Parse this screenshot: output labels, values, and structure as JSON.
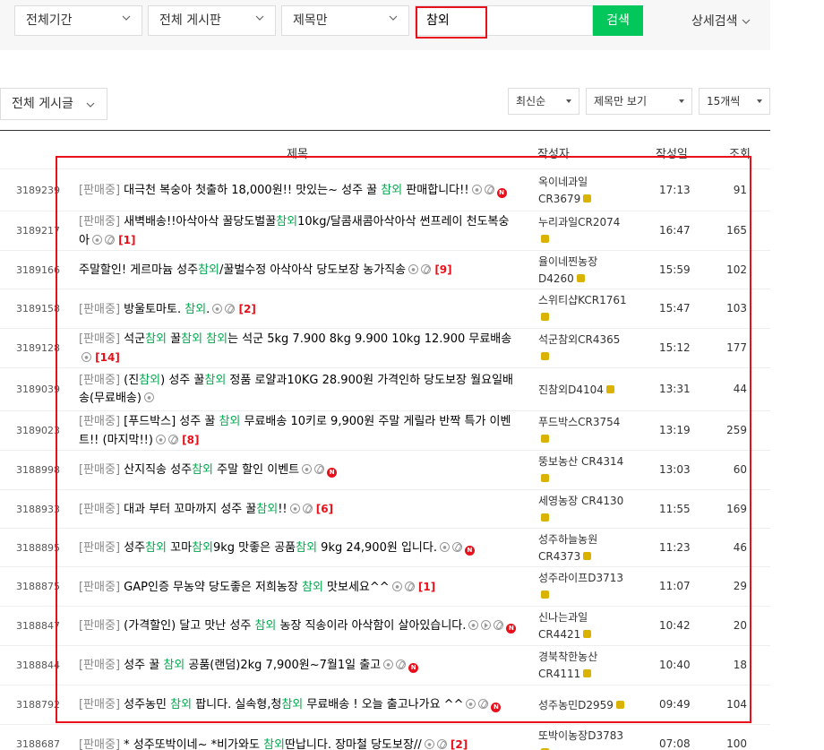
{
  "search": {
    "period": "전체기간",
    "board": "전체 게시판",
    "field": "제목만",
    "query": "참외",
    "button": "검색",
    "advanced": "상세검색"
  },
  "toolbar": {
    "all_posts": "전체 게시글",
    "sort": "최신순",
    "view": "제목만 보기",
    "count": "15개씩"
  },
  "table": {
    "headers": {
      "title": "제목",
      "author": "작성자",
      "date": "작성일",
      "views": "조회"
    },
    "rows": [
      {
        "num": "3189239",
        "head": "[판매중]",
        "parts": [
          "대극천 복숭아 첫출하 18,000원!! 맛있는~ 성주 꿀 ",
          "참외",
          " 판매합니다!!"
        ],
        "icons": [
          "photo",
          "attach",
          "new"
        ],
        "comments": "",
        "author": "옥이네과일 CR3679",
        "date": "17:13",
        "views": "91"
      },
      {
        "num": "3189217",
        "head": "[판매중]",
        "parts": [
          "새벽배송!!아삭아삭 꿀당도벌꿀",
          "참외",
          "10kg/달콤새콤아삭아삭 썬프레이 천도복숭아"
        ],
        "icons": [
          "photo",
          "attach"
        ],
        "comments": "[1]",
        "author": "누리과일CR2074",
        "date": "16:47",
        "views": "165"
      },
      {
        "num": "3189166",
        "head": "",
        "parts": [
          "주말할인! 게르마늄 성주",
          "참외",
          "/꿀벌수정 아삭아삭 당도보장 농가직송"
        ],
        "icons": [
          "photo",
          "attach"
        ],
        "comments": "[9]",
        "author": "율이네찐농장 D4260",
        "date": "15:59",
        "views": "102"
      },
      {
        "num": "3189158",
        "head": "[판매중]",
        "parts": [
          "방울토마토. ",
          "참외",
          "."
        ],
        "icons": [
          "photo",
          "attach"
        ],
        "comments": "[2]",
        "author": "스위티샵KCR1761",
        "date": "15:47",
        "views": "103"
      },
      {
        "num": "3189128",
        "head": "[판매중]",
        "parts": [
          "석군",
          "참외",
          " 꿀",
          "참외",
          " ",
          "참외",
          "는 석군 5kg 7.900 8kg 9.900 10kg 12.900 무료배송"
        ],
        "icons": [
          "photo"
        ],
        "comments": "[14]",
        "author": "석군참외CR4365",
        "date": "15:12",
        "views": "177"
      },
      {
        "num": "3189039",
        "head": "[판매중]",
        "parts": [
          "(진",
          "참외",
          ") 성주 꿀",
          "참외",
          " 정품 로얄과10KG 28.900원 가격인하 당도보장 월요일배송(무료배송)"
        ],
        "icons": [
          "photo"
        ],
        "comments": "",
        "author": "진참외D4104",
        "date": "13:31",
        "views": "44"
      },
      {
        "num": "3189023",
        "head": "[판매중]",
        "parts": [
          "[푸드박스] 성주 꿀 ",
          "참외",
          " 무료배송 10키로 9,900원 주말 게릴라 반짝 특가 이벤트!! (마지막!!)"
        ],
        "icons": [
          "photo",
          "attach"
        ],
        "comments": "[8]",
        "author": "푸드박스CR3754",
        "date": "13:19",
        "views": "259"
      },
      {
        "num": "3188998",
        "head": "[판매중]",
        "parts": [
          "산지직송 성주",
          "참외",
          " 주말 할인 이벤트"
        ],
        "icons": [
          "photo",
          "attach",
          "new"
        ],
        "comments": "",
        "author": "뚱보농산 CR4314",
        "date": "13:03",
        "views": "60"
      },
      {
        "num": "3188933",
        "head": "[판매중]",
        "parts": [
          "대과 부터 꼬마까지 성주 꿀",
          "참외",
          "!!"
        ],
        "icons": [
          "photo",
          "attach"
        ],
        "comments": "[6]",
        "author": "세영농장 CR4130",
        "date": "11:55",
        "views": "169"
      },
      {
        "num": "3188895",
        "head": "[판매중]",
        "parts": [
          "성주",
          "참외",
          " 꼬마",
          "참외",
          "9kg 맛좋은 공품",
          "참외",
          " 9kg 24,900원 입니다."
        ],
        "icons": [
          "photo",
          "attach",
          "new"
        ],
        "comments": "",
        "author": "성주하늘농원 CR4373",
        "date": "11:23",
        "views": "46"
      },
      {
        "num": "3188875",
        "head": "[판매중]",
        "parts": [
          "GAP인증 무농약 당도좋은 저희농장 ",
          "참외",
          " 맛보세요^^"
        ],
        "icons": [
          "photo",
          "attach"
        ],
        "comments": "[1]",
        "author": "성주라이프D3713",
        "date": "11:07",
        "views": "29"
      },
      {
        "num": "3188847",
        "head": "[판매중]",
        "parts": [
          "(가격할인) 달고 맛난 성주 ",
          "참외",
          " 농장 직송이라 아삭함이 살아있습니다."
        ],
        "icons": [
          "photo",
          "video",
          "attach",
          "new"
        ],
        "comments": "",
        "author": "신나는과일 CR4421",
        "date": "10:42",
        "views": "20"
      },
      {
        "num": "3188844",
        "head": "[판매중]",
        "parts": [
          "성주 꿀 ",
          "참외",
          " 공품(랜덤)2kg 7,900원~7월1일 출고"
        ],
        "icons": [
          "photo",
          "attach",
          "new"
        ],
        "comments": "",
        "author": "경북착한농산 CR4111",
        "date": "10:40",
        "views": "18"
      },
      {
        "num": "3188792",
        "head": "[판매중]",
        "parts": [
          "성주농민 ",
          "참외",
          " 팝니다. 실속형,청",
          "참외",
          " 무료배송 ! 오늘 출고나가요 ^^"
        ],
        "icons": [
          "photo",
          "attach",
          "new"
        ],
        "comments": "",
        "author": "성주농민D2959",
        "date": "09:49",
        "views": "104"
      },
      {
        "num": "3188687",
        "head": "[판매중]",
        "parts": [
          "* 성주또박이네~ *비가와도 ",
          "참외",
          "딴납니다. 장마철 당도보장//"
        ],
        "icons": [
          "photo",
          "attach"
        ],
        "comments": "[2]",
        "author": "또박이농장D3783",
        "date": "07:08",
        "views": "100"
      }
    ]
  }
}
